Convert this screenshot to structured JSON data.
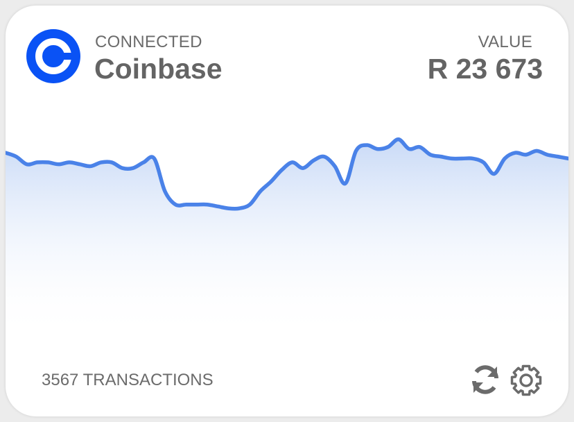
{
  "card": {
    "connected_label": "CONNECTED",
    "exchange_name": "Coinbase",
    "value_label": "VALUE",
    "value_amount": "R 23 673",
    "transactions_label": "3567 TRANSACTIONS"
  },
  "icons": {
    "logo": "coinbase-logo-icon",
    "refresh": "refresh-icon",
    "settings": "gear-icon"
  },
  "colors": {
    "brand": "#0a52f5",
    "line": "#4a82e8",
    "text": "#646464",
    "icon": "#6b6b6b"
  },
  "chart_data": {
    "type": "area",
    "values": [
      60,
      58,
      54,
      55,
      55,
      54,
      55,
      54,
      53,
      55,
      55,
      52,
      52,
      55,
      57,
      40,
      33,
      33,
      33,
      33,
      32,
      31,
      31,
      33,
      40,
      45,
      51,
      55,
      52,
      56,
      58,
      53,
      44,
      61,
      64,
      62,
      63,
      67,
      62,
      63,
      59,
      58,
      57,
      57,
      57,
      55,
      49,
      57,
      60,
      59,
      61,
      59,
      58,
      57
    ]
  }
}
